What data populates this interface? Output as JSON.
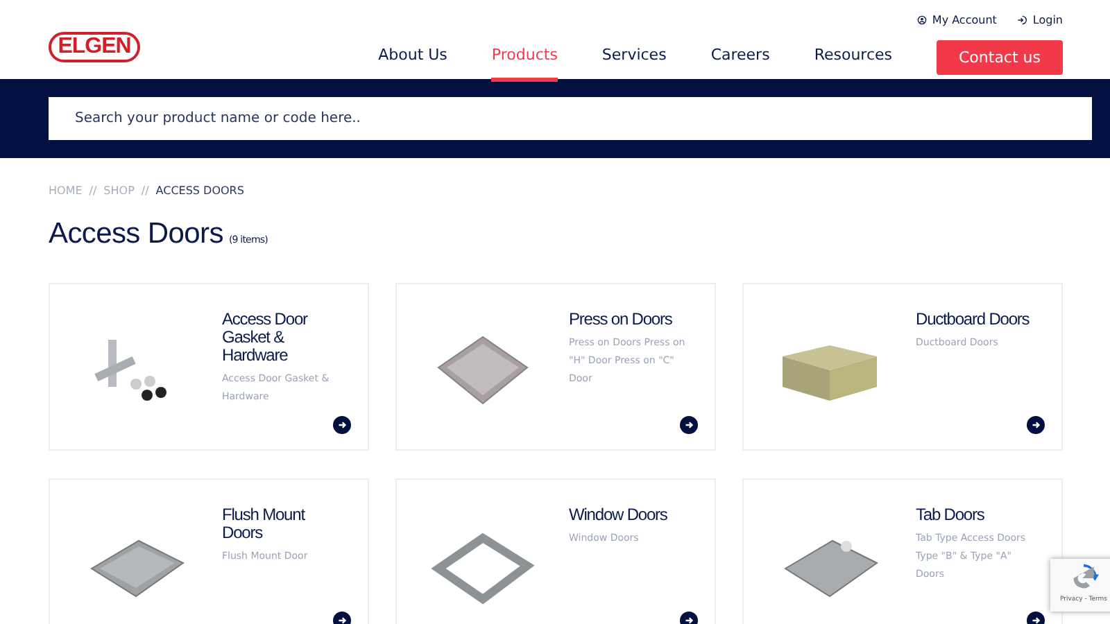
{
  "header": {
    "logo": "ELGEN",
    "utility_links": [
      {
        "label": "My Account"
      },
      {
        "label": "Login"
      }
    ],
    "nav": [
      {
        "label": "About Us",
        "selected": false
      },
      {
        "label": "Products",
        "selected": true
      },
      {
        "label": "Services",
        "selected": false
      },
      {
        "label": "Careers",
        "selected": false
      },
      {
        "label": "Resources",
        "selected": false
      }
    ],
    "contact_button": "Contact us"
  },
  "search": {
    "placeholder": "Search your product name or code here.."
  },
  "breadcrumb": [
    {
      "label": "HOME",
      "current": false
    },
    {
      "label": "SHOP",
      "current": false
    },
    {
      "label": "ACCESS DOORS",
      "current": true
    }
  ],
  "breadcrumb_separator": "//",
  "page_title": "Access Doors",
  "item_count": "(9 items)",
  "products": [
    {
      "name": "Access Door Gasket & Hardware",
      "description": "Access Door Gasket & Hardware"
    },
    {
      "name": "Press on Doors",
      "description": "Press on Doors Press on \"H\" Door Press on \"C\" Door"
    },
    {
      "name": "Ductboard Doors",
      "description": "Ductboard Doors"
    },
    {
      "name": "Flush Mount Doors",
      "description": "Flush Mount Door"
    },
    {
      "name": "Window Doors",
      "description": "Window Doors"
    },
    {
      "name": "Tab Doors",
      "description": "Tab Type Access Doors Type \"B\" & Type \"A\" Doors"
    }
  ],
  "recaptcha": {
    "links": "Privacy - Terms"
  }
}
